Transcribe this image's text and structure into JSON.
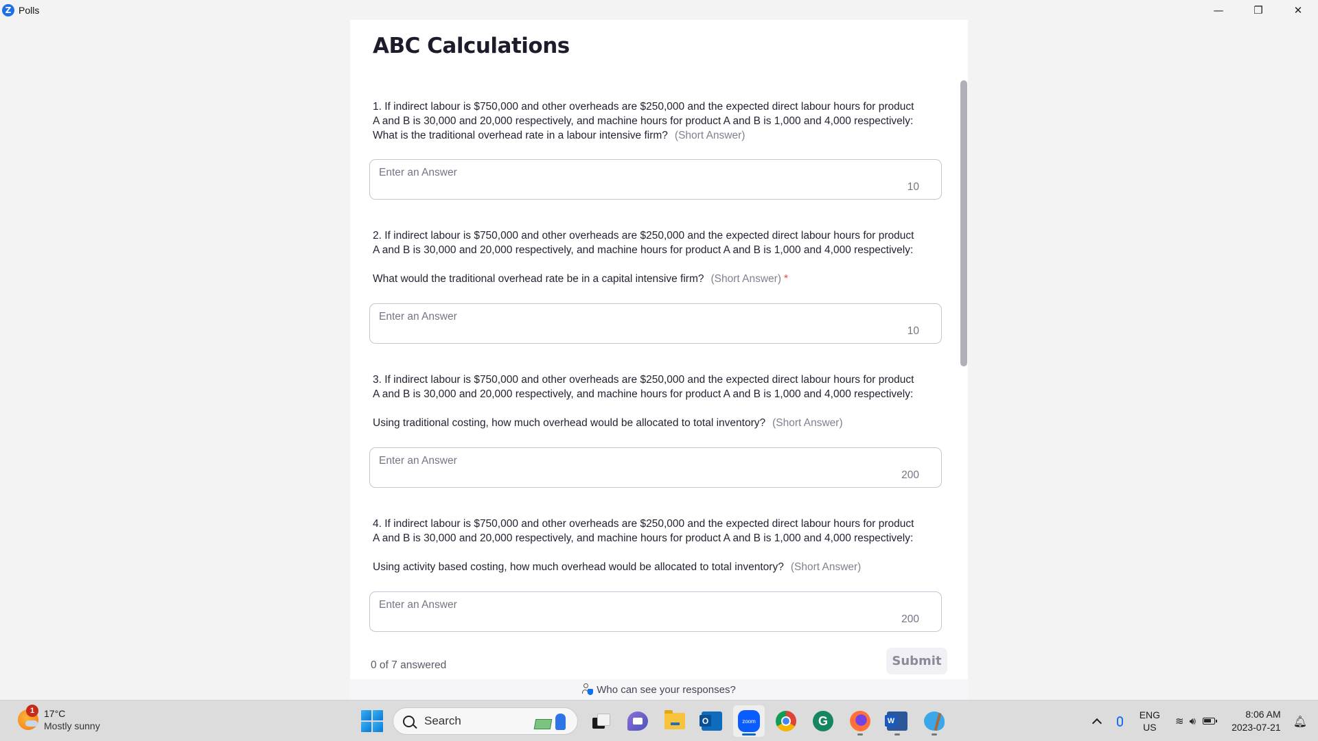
{
  "window": {
    "app_icon": "zoom-logo-icon",
    "app_logo_letter": "Z",
    "title": "Polls",
    "controls": {
      "minimize": "—",
      "restore": "❐",
      "close": "✕"
    }
  },
  "poll": {
    "title": "ABC Calculations",
    "answer_placeholder": "Enter an Answer",
    "questions": [
      {
        "number": 1,
        "text": "1. If indirect labour is $750,000 and other overheads are $250,000 and the expected direct labour hours for product A and B  is 30,000 and 20,000 respectively, and machine hours for product A and B is 1,000 and 4,000 respectively: What is the traditional overhead rate in a labour intensive firm?",
        "prompt": "",
        "type_label": "(Short Answer)",
        "required": false,
        "answer": "",
        "char_limit": "10"
      },
      {
        "number": 2,
        "text": "2. If indirect labour is $750,000 and other overheads are $250,000 and the expected direct labour hours for product A and B  is 30,000 and 20,000 respectively, and machine hours for product A and B is 1,000 and 4,000 respectively:",
        "prompt": "What would the traditional overhead rate be in a capital intensive firm?",
        "type_label": "(Short Answer)",
        "required": true,
        "required_mark": "*",
        "answer": "",
        "char_limit": "10"
      },
      {
        "number": 3,
        "text": "3. If indirect labour is $750,000 and other overheads are $250,000 and the expected direct labour hours for product A and B  is 30,000 and 20,000 respectively, and machine hours for product A and B is 1,000 and 4,000 respectively:",
        "prompt": "Using traditional costing, how much overhead would be allocated to total inventory?",
        "type_label": "(Short Answer)",
        "required": false,
        "answer": "",
        "char_limit": "200"
      },
      {
        "number": 4,
        "text": "4. If indirect labour is $750,000 and other overheads are $250,000 and the expected direct labour hours for product A and B  is 30,000 and 20,000 respectively, and machine hours for product A and B is 1,000 and 4,000 respectively:",
        "prompt": "Using activity based costing, how much overhead would be allocated to total inventory?",
        "type_label": "(Short Answer)",
        "required": false,
        "answer": "",
        "char_limit": "200"
      }
    ],
    "answered_status": "0 of 7 answered",
    "submit_label": "Submit",
    "visibility_link": "Who can see your responses?",
    "scroll_fraction": 0.0,
    "colors": {
      "required": "#e0493f",
      "submit_disabled_bg": "#f1f1f5",
      "brand": "#0e72ed"
    }
  },
  "taskbar": {
    "weather": {
      "temperature": "17°C",
      "condition": "Mostly sunny",
      "badge_count": "1"
    },
    "search_label": "Search",
    "apps": [
      {
        "name": "task-view",
        "running": false,
        "active": false
      },
      {
        "name": "teams-chat",
        "running": false,
        "active": false
      },
      {
        "name": "file-explorer",
        "running": false,
        "active": false
      },
      {
        "name": "outlook",
        "running": false,
        "active": false
      },
      {
        "name": "zoom",
        "label": "zoom",
        "running": true,
        "active": true
      },
      {
        "name": "chrome",
        "running": false,
        "active": false
      },
      {
        "name": "grammarly",
        "label": "G",
        "running": false,
        "active": false
      },
      {
        "name": "firefox",
        "running": true,
        "active": false
      },
      {
        "name": "word",
        "running": true,
        "active": false
      },
      {
        "name": "paint",
        "running": true,
        "active": false
      }
    ],
    "tray": {
      "language_line1": "ENG",
      "language_line2": "US",
      "wifi_glyph": "≋",
      "volume_glyph": "🔊︎",
      "time": "8:06 AM",
      "date": "2023-07-21",
      "notification_glyph": "🔔︎"
    }
  }
}
